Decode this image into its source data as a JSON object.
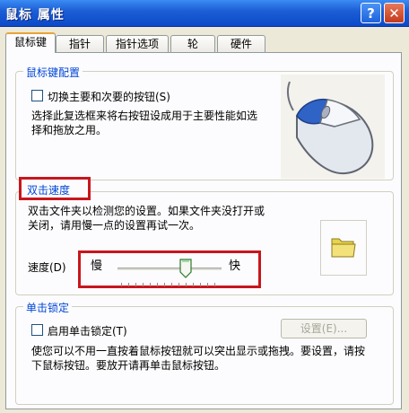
{
  "window": {
    "title": "鼠标 属性",
    "help_label": "?",
    "close_label": "✕"
  },
  "tabs": [
    {
      "label": "鼠标键",
      "active": true
    },
    {
      "label": "指针",
      "active": false
    },
    {
      "label": "指针选项",
      "active": false
    },
    {
      "label": "轮",
      "active": false
    },
    {
      "label": "硬件",
      "active": false
    }
  ],
  "button_config": {
    "legend": "鼠标键配置",
    "checkbox_label": "切换主要和次要的按钮(S)",
    "checked": false,
    "description": "选择此复选框来将右按钮设成用于主要性能如选择和拖放之用。",
    "image_icon": "mouse-icon"
  },
  "double_click": {
    "legend": "双击速度",
    "description": "双击文件夹以检测您的设置。如果文件夹没打开或关闭，请用慢一点的设置再试一次。",
    "speed_label": "速度(D)",
    "slow_label": "慢",
    "fast_label": "快",
    "speed_level": 0.6,
    "test_icon": "folder-icon"
  },
  "click_lock": {
    "legend": "单击锁定",
    "checkbox_label": "启用单击锁定(T)",
    "checked": false,
    "settings_label": "设置(E)...",
    "description": "使您可以不用一直按着鼠标按钮就可以突出显示或拖拽。要设置，请按下鼠标按钮。要放开请再单击鼠标按钮。"
  },
  "colors": {
    "titlebar": "#0a49c9",
    "highlight_border": "#c8161d",
    "group_label": "#0046d5"
  }
}
